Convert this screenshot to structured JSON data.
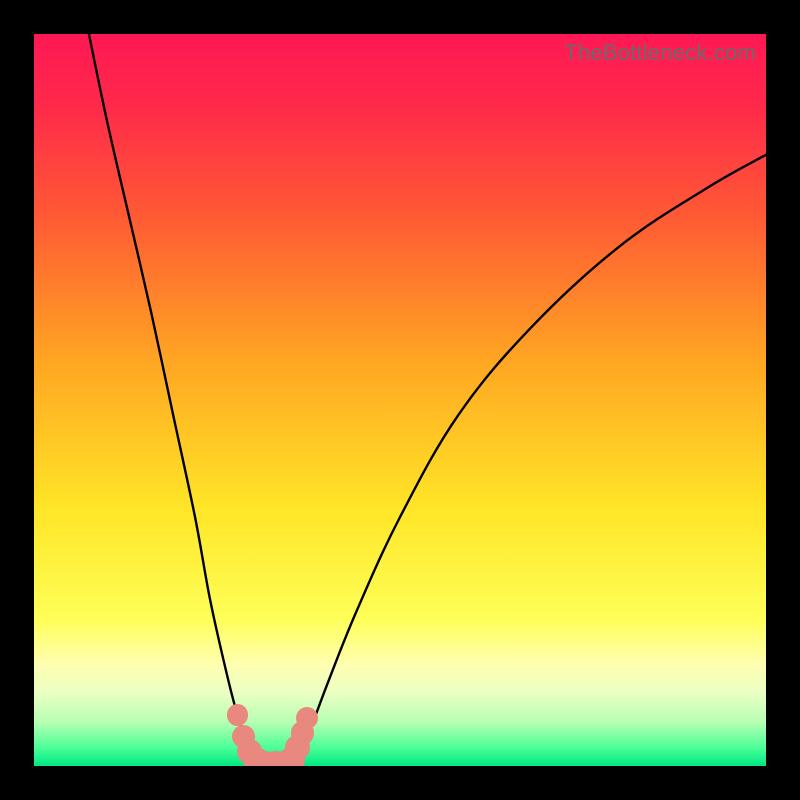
{
  "watermark": "TheBottleneck.com",
  "chart_data": {
    "type": "line",
    "title": "",
    "xlabel": "",
    "ylabel": "",
    "xlim": [
      0,
      100
    ],
    "ylim": [
      0,
      100
    ],
    "gradient_stops": [
      {
        "offset": 0.0,
        "color": "#ff1854"
      },
      {
        "offset": 0.1,
        "color": "#ff2a4a"
      },
      {
        "offset": 0.25,
        "color": "#ff5a34"
      },
      {
        "offset": 0.45,
        "color": "#ffa722"
      },
      {
        "offset": 0.65,
        "color": "#ffe627"
      },
      {
        "offset": 0.8,
        "color": "#feff58"
      },
      {
        "offset": 0.86,
        "color": "#ffffb0"
      },
      {
        "offset": 0.9,
        "color": "#eaffc3"
      },
      {
        "offset": 0.94,
        "color": "#b7ffb3"
      },
      {
        "offset": 0.975,
        "color": "#4bff97"
      },
      {
        "offset": 1.0,
        "color": "#00e884"
      }
    ],
    "series": [
      {
        "name": "left-branch",
        "x": [
          7.5,
          10,
          13,
          16,
          19,
          22,
          24,
          26,
          27.5,
          28.8,
          30,
          31.3
        ],
        "y": [
          100,
          88,
          75,
          62,
          48,
          34,
          23,
          14,
          8,
          4,
          1.5,
          0
        ]
      },
      {
        "name": "right-branch",
        "x": [
          35.5,
          37,
          40,
          44,
          50,
          58,
          68,
          80,
          92,
          100
        ],
        "y": [
          0,
          3,
          11,
          21,
          34,
          48,
          60,
          71,
          79,
          83.5
        ]
      }
    ],
    "markers": {
      "name": "bottom-dots",
      "color": "#e8887f",
      "points": [
        {
          "x": 27.8,
          "y": 7.0,
          "r": 1.5
        },
        {
          "x": 28.6,
          "y": 4.0,
          "r": 1.6
        },
        {
          "x": 29.4,
          "y": 2.0,
          "r": 1.7
        },
        {
          "x": 30.3,
          "y": 0.8,
          "r": 1.8
        },
        {
          "x": 31.5,
          "y": 0.3,
          "r": 1.8
        },
        {
          "x": 33.0,
          "y": 0.3,
          "r": 1.8
        },
        {
          "x": 34.3,
          "y": 0.3,
          "r": 1.8
        },
        {
          "x": 35.2,
          "y": 0.8,
          "r": 1.8
        },
        {
          "x": 36.0,
          "y": 2.5,
          "r": 1.7
        },
        {
          "x": 36.7,
          "y": 4.5,
          "r": 1.6
        },
        {
          "x": 37.3,
          "y": 6.5,
          "r": 1.5
        }
      ]
    }
  }
}
